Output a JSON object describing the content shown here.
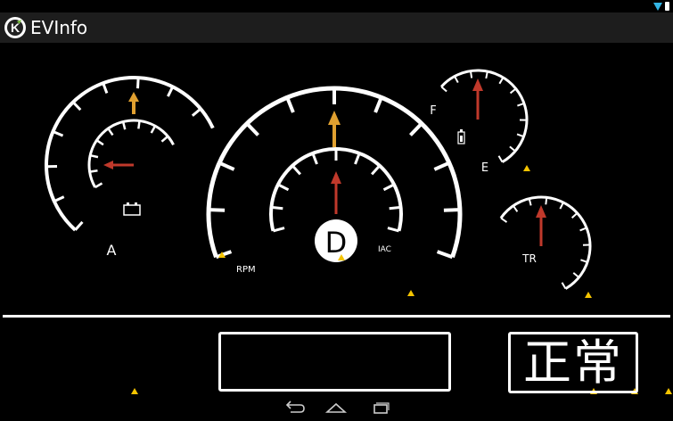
{
  "app": {
    "title": "EVInfo",
    "logo_letter": "K"
  },
  "gauges": {
    "voltage": {
      "end_label": "A",
      "outer_needle": "up",
      "inner_needle": "left"
    },
    "speed": {
      "gear": "D",
      "rpm_label": "RPM",
      "current_label": "IAC"
    },
    "fuel": {
      "full_label": "F",
      "empty_label": "E"
    },
    "temperature": {
      "label": "TR"
    }
  },
  "status": {
    "message": "",
    "state": "正常"
  },
  "colors": {
    "needle_orange": "#e0a030",
    "needle_red": "#c0392b",
    "warning": "#f5c400",
    "accent": "#33b5e5"
  },
  "nav": {
    "back_icon": "back-icon",
    "home_icon": "home-icon",
    "recents_icon": "recents-icon"
  }
}
